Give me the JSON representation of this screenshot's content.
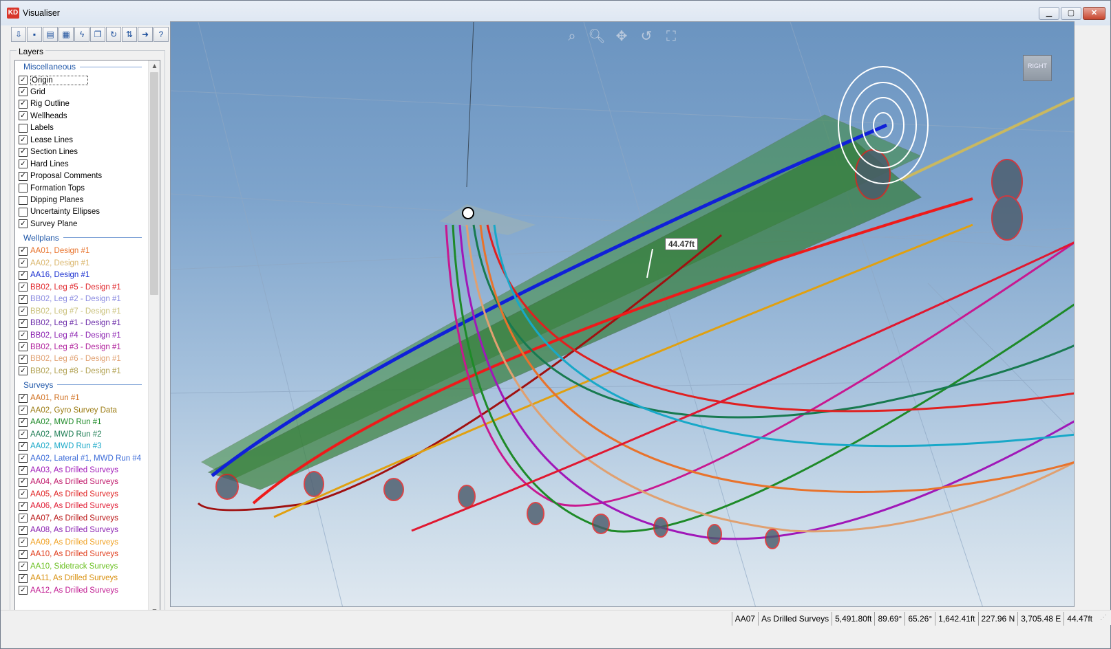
{
  "window": {
    "title": "Visualiser",
    "icon_text": "KD"
  },
  "toolbar": {
    "buttons": [
      "import-icon",
      "save-icon",
      "open-icon",
      "calculator-icon",
      "lightning-icon",
      "copy-icon",
      "refresh-icon",
      "swap-icon",
      "export-icon",
      "help-icon"
    ],
    "glyphs": [
      "⇩",
      "▪",
      "▤",
      "▦",
      "ϟ",
      "❐",
      "↻",
      "⇅",
      "➜",
      "?"
    ]
  },
  "layers": {
    "caption": "Layers",
    "misc_header": "Miscellaneous",
    "misc": [
      {
        "label": "Origin",
        "checked": true
      },
      {
        "label": "Grid",
        "checked": true
      },
      {
        "label": "Rig Outline",
        "checked": true
      },
      {
        "label": "Wellheads",
        "checked": true
      },
      {
        "label": "Labels",
        "checked": false
      },
      {
        "label": "Lease Lines",
        "checked": true
      },
      {
        "label": "Section Lines",
        "checked": true
      },
      {
        "label": "Hard Lines",
        "checked": true
      },
      {
        "label": "Proposal Comments",
        "checked": true
      },
      {
        "label": "Formation Tops",
        "checked": false
      },
      {
        "label": "Dipping Planes",
        "checked": false
      },
      {
        "label": "Uncertainty Ellipses",
        "checked": false
      },
      {
        "label": "Survey Plane",
        "checked": true
      }
    ],
    "wellplans_header": "Wellplans",
    "wellplans": [
      {
        "label": "AA01, Design #1",
        "color": "#e8732c"
      },
      {
        "label": "AA02, Design #1",
        "color": "#d9b56a"
      },
      {
        "label": "AA16, Design #1",
        "color": "#1a2fd0"
      },
      {
        "label": "BB02, Leg #5 - Design #1",
        "color": "#e0242a"
      },
      {
        "label": "BB02, Leg #2 - Design #1",
        "color": "#8a8ae0"
      },
      {
        "label": "BB02, Leg #7 - Design #1",
        "color": "#c9c07a"
      },
      {
        "label": "BB02, Leg #1 - Design #1",
        "color": "#6a2aa8"
      },
      {
        "label": "BB02, Leg #4 - Design #1",
        "color": "#8a1fb0"
      },
      {
        "label": "BB02, Leg #3 - Design #1",
        "color": "#b0209c"
      },
      {
        "label": "BB02, Leg #6 - Design #1",
        "color": "#e0a070"
      },
      {
        "label": "BB02, Leg #8 - Design #1",
        "color": "#b0a050"
      }
    ],
    "surveys_header": "Surveys",
    "surveys": [
      {
        "label": "AA01, Run #1",
        "color": "#d07020"
      },
      {
        "label": "AA02, Gyro Survey Data",
        "color": "#9a7a10"
      },
      {
        "label": "AA02, MWD Run #1",
        "color": "#1e8a28"
      },
      {
        "label": "AA02, MWD Run #2",
        "color": "#187a50"
      },
      {
        "label": "AA02, MWD Run #3",
        "color": "#18a8c8"
      },
      {
        "label": "AA02, Lateral #1, MWD Run #4",
        "color": "#3a6ad8"
      },
      {
        "label": "AA03, As Drilled Surveys",
        "color": "#a018b8"
      },
      {
        "label": "AA04, As Drilled Surveys",
        "color": "#c0186a"
      },
      {
        "label": "AA05, As Drilled Surveys",
        "color": "#e02020"
      },
      {
        "label": "AA06, As Drilled Surveys",
        "color": "#e01830"
      },
      {
        "label": "AA07, As Drilled Surveys",
        "color": "#b81010"
      },
      {
        "label": "AA08, As Drilled Surveys",
        "color": "#8a1fb0"
      },
      {
        "label": "AA09, As Drilled Surveys",
        "color": "#f0a020"
      },
      {
        "label": "AA10, As Drilled Surveys",
        "color": "#e03a18"
      },
      {
        "label": "AA10, Sidetrack Surveys",
        "color": "#6ac020"
      },
      {
        "label": "AA11, As Drilled Surveys",
        "color": "#d89010"
      },
      {
        "label": "AA12, As Drilled Surveys",
        "color": "#c01890"
      }
    ]
  },
  "viewport": {
    "tools": [
      {
        "name": "zoom-extents-icon",
        "glyph": "⌕"
      },
      {
        "name": "zoom-icon",
        "glyph": "🔍︎"
      },
      {
        "name": "pan-icon",
        "glyph": "✥"
      },
      {
        "name": "rotate-icon",
        "glyph": "↺"
      },
      {
        "name": "fullscreen-icon",
        "glyph": "⛶"
      }
    ],
    "navcube_label": "RIGHT",
    "measurement": "44.47ft"
  },
  "status": [
    "AA07",
    "As Drilled Surveys",
    "5,491.80ft",
    "89.69°",
    "65.26°",
    "1,642.41ft",
    "227.96 N",
    "3,705.48 E",
    "44.47ft"
  ]
}
